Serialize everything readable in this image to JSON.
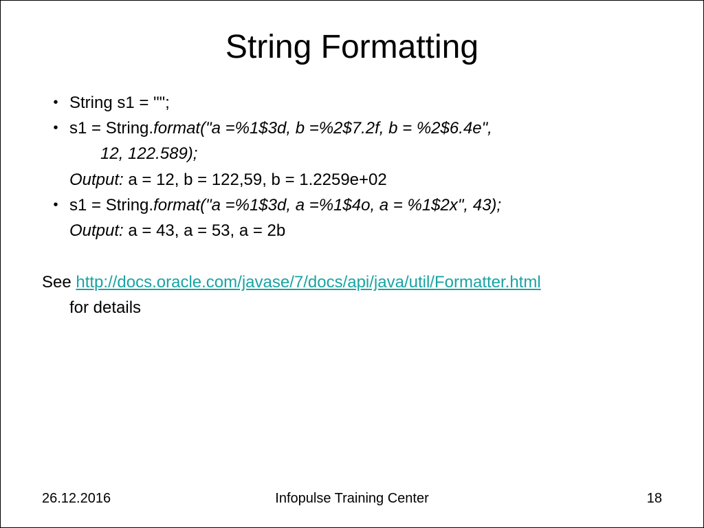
{
  "title": "String Formatting",
  "bullets": {
    "b1": "String s1 = \"\";",
    "b2_prefix": "s1 = String.",
    "b2_italic": "format(\"a =%1$3d, b =%2$7.2f, b = %2$6.4e\",",
    "b2_line2": "12, 122.589);",
    "b2_output_label": "Output:",
    "b2_output_value": "  a = 12, b = 122,59, b = 1.2259e+02",
    "b3_prefix": "s1 = String.",
    "b3_italic": "format(\"a =%1$3d, a =%1$4o, a = %1$2x\", 43);",
    "b3_output_label": "Output:",
    "b3_output_value": "  a = 43, a =  53, a = 2b"
  },
  "see": {
    "prefix": "See ",
    "link": "http://docs.oracle.com/javase/7/docs/api/java/util/Formatter.html",
    "suffix": "for details"
  },
  "footer": {
    "date": "26.12.2016",
    "center": "Infopulse Training Center",
    "page": "18"
  }
}
